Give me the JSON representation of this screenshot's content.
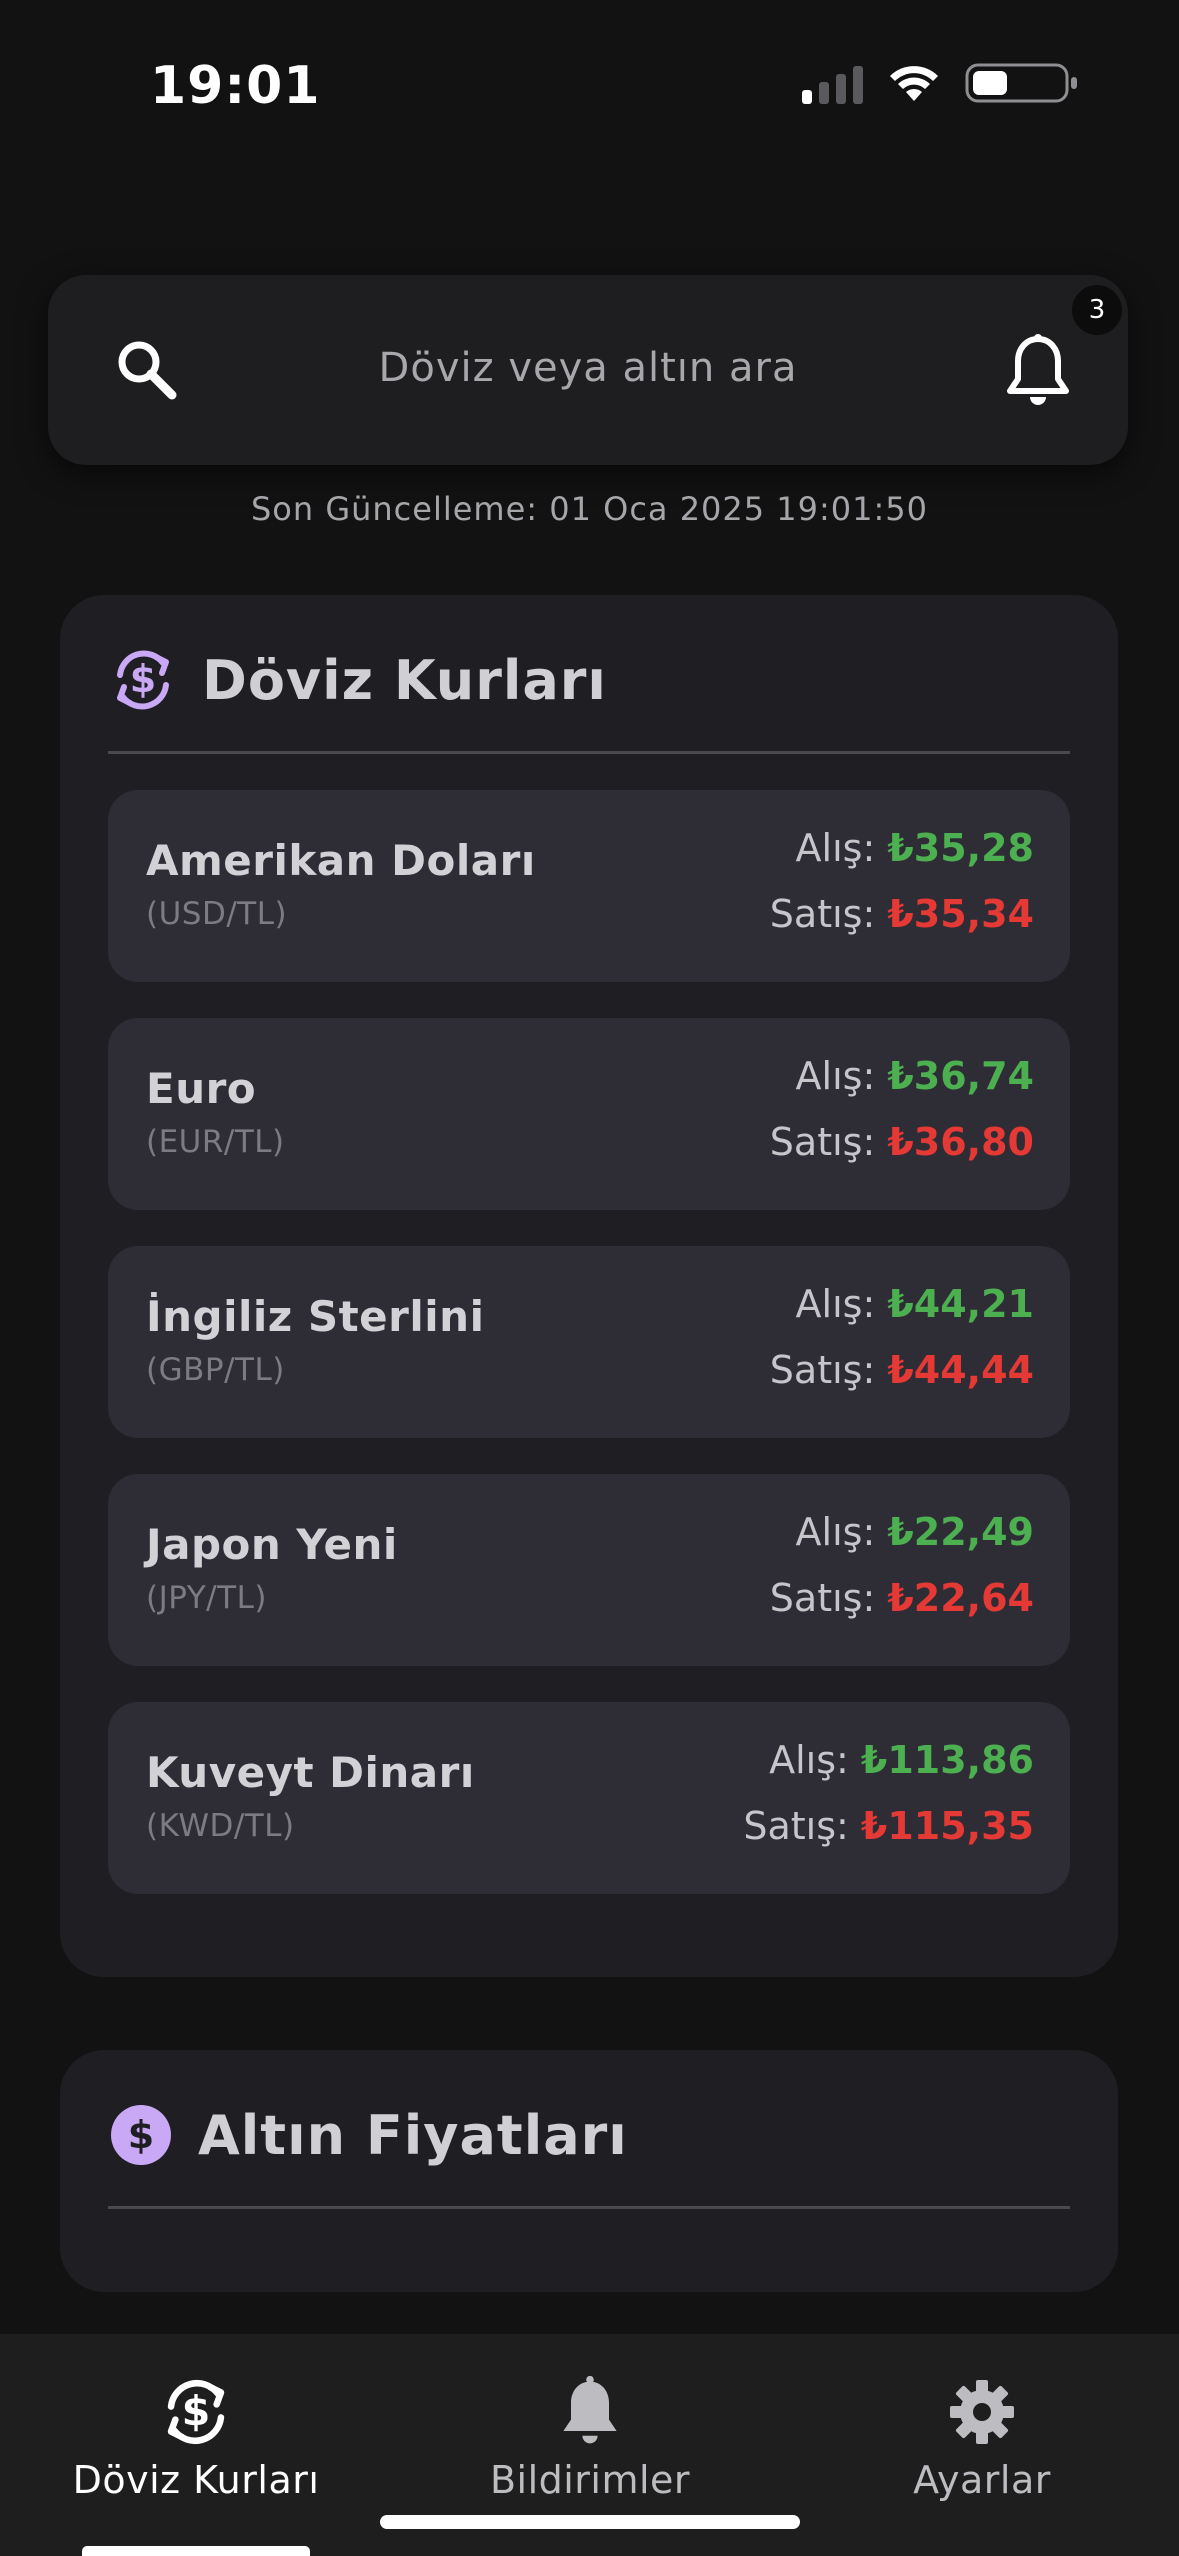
{
  "status_bar": {
    "time": "19:01"
  },
  "search": {
    "placeholder": "Döviz veya altın ara",
    "notification_count": "3"
  },
  "last_update": "Son Güncelleme: 01 Oca 2025 19:01:50",
  "colors": {
    "accent": "#c9a8f5",
    "buy": "#4caf50",
    "sell": "#e53935"
  },
  "currency_section": {
    "title": "Döviz Kurları",
    "icon": "currency-exchange-icon",
    "rates": [
      {
        "name": "Amerikan Doları",
        "code": "(USD/TL)",
        "buy_label": "Alış:",
        "buy": "₺35,28",
        "sell_label": "Satış:",
        "sell": "₺35,34"
      },
      {
        "name": "Euro",
        "code": "(EUR/TL)",
        "buy_label": "Alış:",
        "buy": "₺36,74",
        "sell_label": "Satış:",
        "sell": "₺36,80"
      },
      {
        "name": "İngiliz Sterlini",
        "code": "(GBP/TL)",
        "buy_label": "Alış:",
        "buy": "₺44,21",
        "sell_label": "Satış:",
        "sell": "₺44,44"
      },
      {
        "name": "Japon Yeni",
        "code": "(JPY/TL)",
        "buy_label": "Alış:",
        "buy": "₺22,49",
        "sell_label": "Satış:",
        "sell": "₺22,64"
      },
      {
        "name": "Kuveyt Dinarı",
        "code": "(KWD/TL)",
        "buy_label": "Alış:",
        "buy": "₺113,86",
        "sell_label": "Satış:",
        "sell": "₺115,35"
      }
    ]
  },
  "gold_section": {
    "title": "Altın Fiyatları",
    "icon": "dollar-circle-icon"
  },
  "bottom_nav": {
    "items": [
      {
        "label": "Döviz Kurları",
        "icon": "currency-exchange-icon",
        "active": true
      },
      {
        "label": "Bildirimler",
        "icon": "bell-icon",
        "active": false
      },
      {
        "label": "Ayarlar",
        "icon": "gear-icon",
        "active": false
      }
    ]
  }
}
